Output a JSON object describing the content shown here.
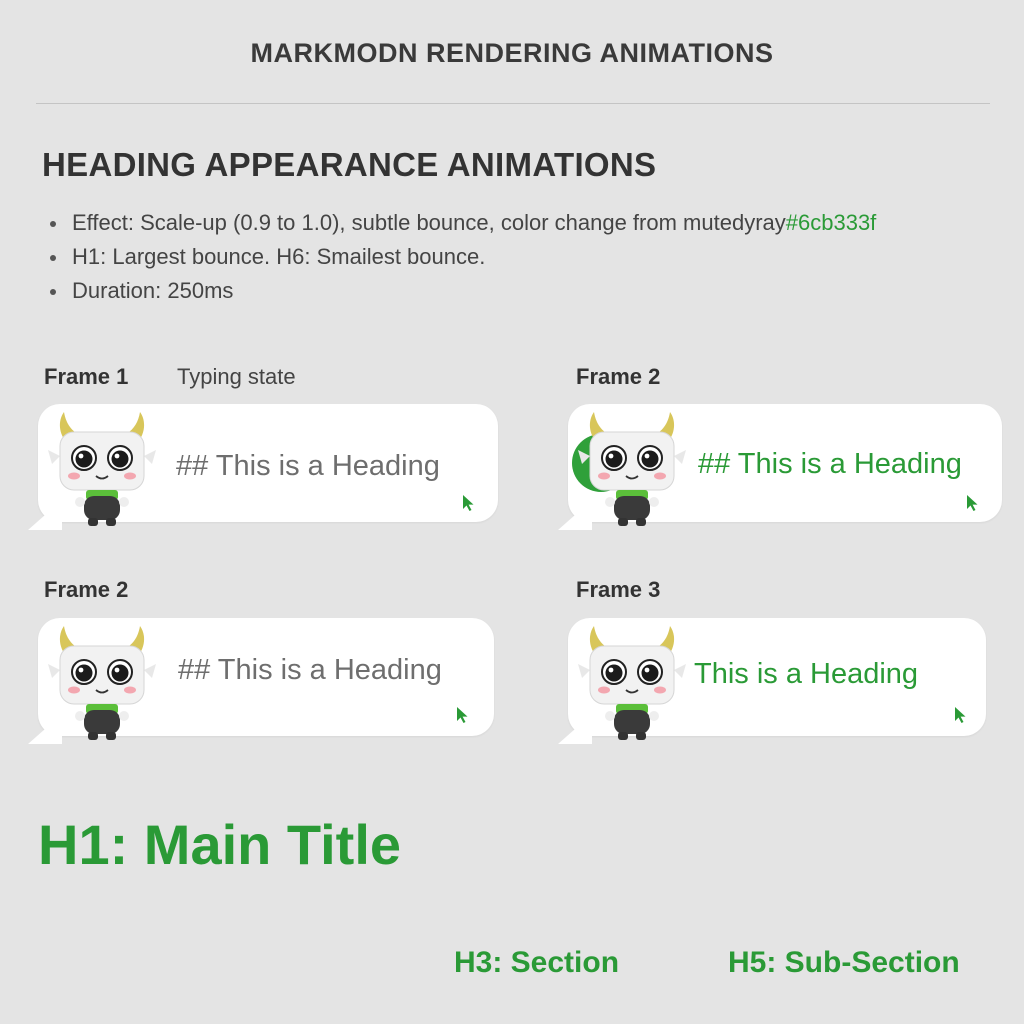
{
  "page": {
    "title": "MARKMODN RENDERING ANIMATIONS"
  },
  "section": {
    "heading": "HEADING APPEARANCE ANIMATIONS",
    "bullets": [
      {
        "text": "Effect: Scale-up (0.9 to 1.0), subtle bounce, color change from mutedyray",
        "accent": "#6cb333f"
      },
      {
        "text": "H1: Largest bounce. H6: Smailest bounce.",
        "accent": ""
      },
      {
        "text": " Duration: 250ms",
        "accent": ""
      }
    ]
  },
  "frames": [
    {
      "label": "Frame 1",
      "sublabel": "Typing state",
      "heading_text": "## This is a Heading",
      "style": "muted"
    },
    {
      "label": "Frame 2",
      "sublabel": "",
      "heading_text": "## This is a Heading",
      "style": "green"
    },
    {
      "label": "Frame 2",
      "sublabel": "",
      "heading_text": "## This is a Heading",
      "style": "muted"
    },
    {
      "label": "Frame 3",
      "sublabel": "",
      "heading_text": "This is a Heading",
      "style": "green"
    }
  ],
  "examples": {
    "h1": "H1: Main Title",
    "h3": "H3: Section",
    "h5": "H5: Sub-Section"
  },
  "colors": {
    "accent_green": "#2a9a36",
    "muted_gray": "#6e6e6e",
    "background": "#e4e4e4",
    "bubble": "#ffffff"
  },
  "icons": {
    "mascot": "horned-robot-mascot",
    "cursor": "mouse-pointer-icon"
  }
}
